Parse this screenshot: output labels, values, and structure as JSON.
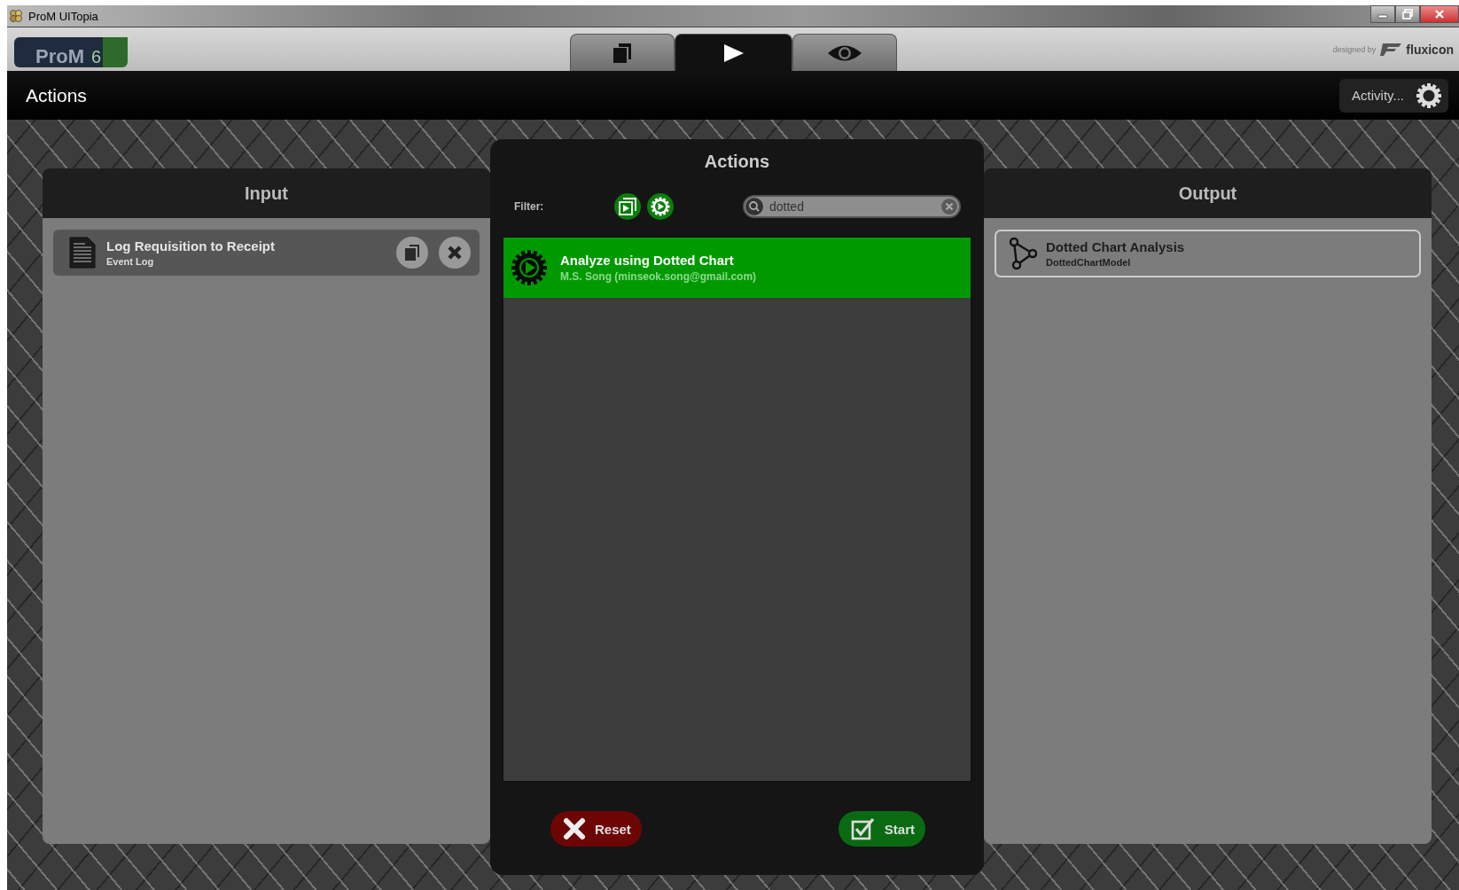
{
  "window": {
    "title": "ProM UITopia"
  },
  "logo": {
    "name": "ProM",
    "version": "6"
  },
  "tabs": [
    {
      "kind": "workspace",
      "selected": false
    },
    {
      "kind": "actions",
      "selected": true
    },
    {
      "kind": "view",
      "selected": false
    }
  ],
  "credit": {
    "prefix": "designed by",
    "brand": "fluxicon"
  },
  "header": {
    "title": "Actions",
    "activity_button": "Activity..."
  },
  "input": {
    "title": "Input",
    "items": [
      {
        "name": "Log Requisition to Receipt",
        "type": "Event Log"
      }
    ]
  },
  "actions": {
    "title": "Actions",
    "filter_label": "Filter:",
    "filters": [
      {
        "kind": "visualizer",
        "selected": true
      },
      {
        "kind": "plugin",
        "selected": true
      }
    ],
    "search": {
      "value": "dotted"
    },
    "items": [
      {
        "name": "Analyze using Dotted Chart",
        "author": "M.S. Song (minseok.song@gmail.com)",
        "selected": true
      }
    ],
    "buttons": [
      {
        "kind": "reset",
        "label": "Reset"
      },
      {
        "kind": "start",
        "label": "Start"
      }
    ]
  },
  "output": {
    "title": "Output",
    "items": [
      {
        "name": "Dotted Chart Analysis",
        "type": "DottedChartModel"
      }
    ]
  }
}
